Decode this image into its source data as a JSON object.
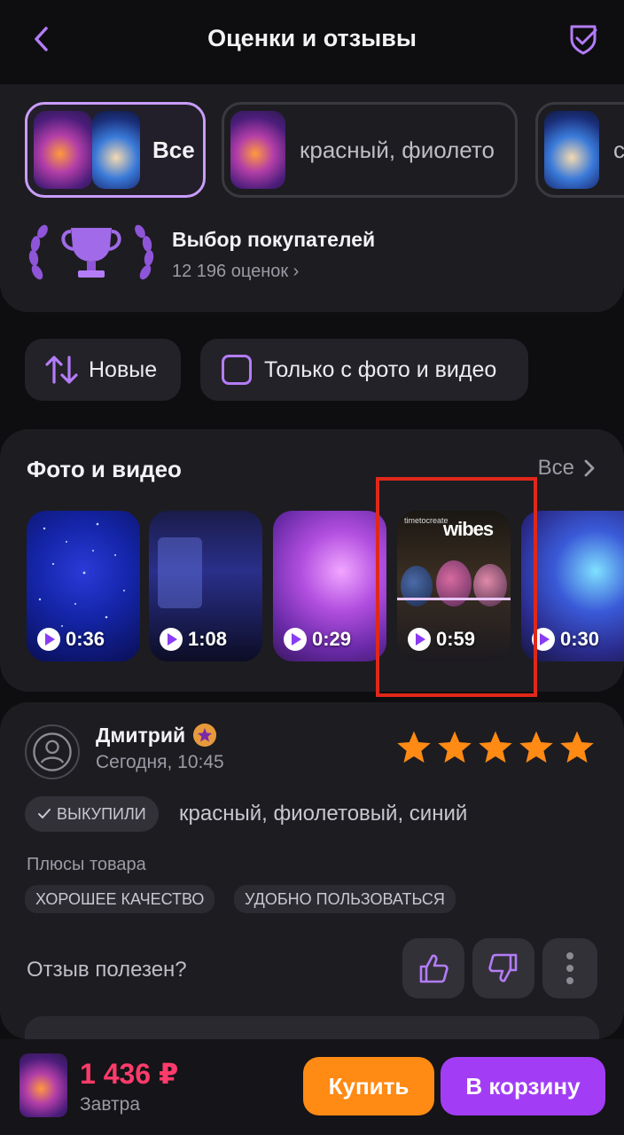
{
  "header": {
    "title": "Оценки и отзывы",
    "back_icon": "chevron-left-icon",
    "action_icon": "shield-check-icon"
  },
  "variants": [
    {
      "label": "Все",
      "selected": true
    },
    {
      "label": "красный, фиолето",
      "selected": false
    },
    {
      "label": "с",
      "selected": false
    }
  ],
  "award": {
    "title": "Выбор покупателей",
    "count": "12 196 оценок ›"
  },
  "filters": {
    "sort_label": "Новые",
    "media_only_label": "Только с фото и видео"
  },
  "photos": {
    "title": "Фото и видео",
    "all_label": "Все",
    "videos": [
      {
        "duration": "0:36"
      },
      {
        "duration": "1:08"
      },
      {
        "duration": "0:29"
      },
      {
        "duration": "0:59",
        "caption": "wibes",
        "watermark": "timetocreate"
      },
      {
        "duration": "0:30"
      }
    ]
  },
  "review": {
    "author": "Дмитрий",
    "date": "Сегодня, 10:45",
    "rating": 5,
    "bought_label": "ВЫКУПИЛИ",
    "variant": "красный, фиолетовый, синий",
    "pros_title": "Плюсы товара",
    "tags": [
      "ХОРОШЕЕ КАЧЕСТВО",
      "УДОБНО ПОЛЬЗОВАТЬСЯ"
    ],
    "useful_question": "Отзыв полезен?"
  },
  "bottom": {
    "price": "1 436 ₽",
    "delivery": "Завтра",
    "buy_label": "Купить",
    "cart_label": "В корзину"
  },
  "colors": {
    "accent": "#a23df5",
    "buy": "#ff8a14",
    "price": "#ff3b6b",
    "star": "#ff8a14",
    "highlight": "#e0281a"
  }
}
